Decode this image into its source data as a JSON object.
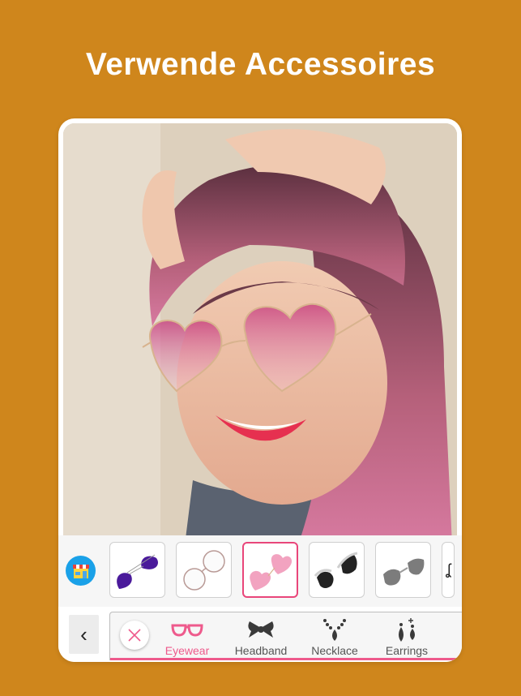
{
  "headline": "Verwende Accessoires",
  "colors": {
    "background": "#CF861C",
    "accent": "#EE5A8C",
    "icon_dark": "#3a3a3a"
  },
  "tray": {
    "store_icon": "store-icon",
    "items": [
      {
        "name": "purple-aviator-sunglasses",
        "selected": false
      },
      {
        "name": "round-clear-glasses",
        "selected": false
      },
      {
        "name": "pink-heart-sunglasses",
        "selected": true
      },
      {
        "name": "jeweled-cat-eye-sunglasses",
        "selected": false
      },
      {
        "name": "gray-cat-eye-sunglasses",
        "selected": false
      },
      {
        "name": "partial-item",
        "selected": false
      }
    ]
  },
  "tabbar": {
    "back_glyph": "‹",
    "clear_icon": "close-icon",
    "tabs": [
      {
        "label": "Eyewear",
        "icon": "glasses-icon",
        "active": true
      },
      {
        "label": "Headband",
        "icon": "bow-icon",
        "active": false
      },
      {
        "label": "Necklace",
        "icon": "necklace-icon",
        "active": false
      },
      {
        "label": "Earrings",
        "icon": "earrings-icon",
        "active": false
      }
    ]
  }
}
